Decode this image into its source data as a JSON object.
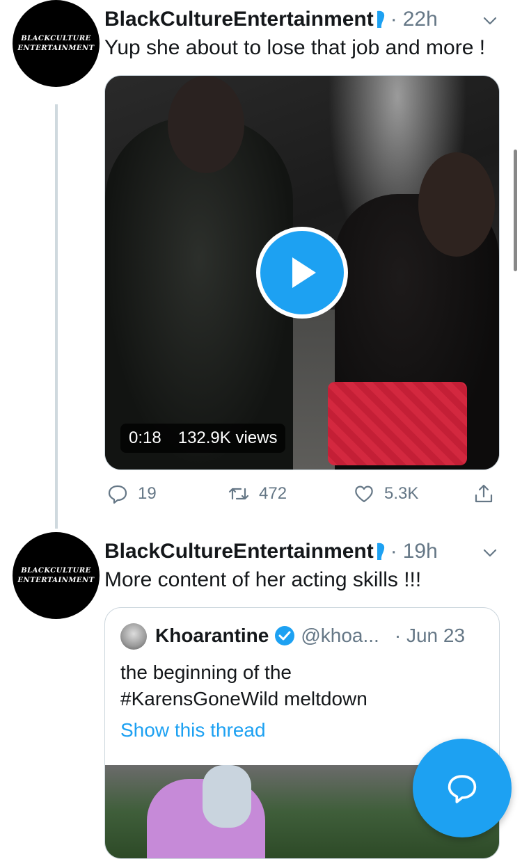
{
  "tweets": [
    {
      "author": "BlackCultureEntertainment",
      "avatar_text": [
        "BLACKCULTURE",
        "ENTERTAINMENT"
      ],
      "time": "22h",
      "dot": "·",
      "text": "Yup she about to lose that job and more !",
      "video": {
        "duration": "0:18",
        "views": "132.9K views"
      },
      "actions": {
        "replies": "19",
        "retweets": "472",
        "likes": "5.3K"
      }
    },
    {
      "author": "BlackCultureEntertainment",
      "avatar_text": [
        "BLACKCULTURE",
        "ENTERTAINMENT"
      ],
      "time": "19h",
      "dot": "·",
      "text": "More content of her acting skills !!!",
      "quote": {
        "name": "Khoarantine",
        "handle": "@khoa...",
        "dot": "·",
        "date": "Jun 23",
        "text_line1": "the beginning of the",
        "text_line2": "#KarensGoneWild  meltdown",
        "link": "Show this thread"
      }
    }
  ],
  "colors": {
    "accent": "#1da1f2",
    "muted": "#657786",
    "text": "#14171a",
    "flag": "#1da1f2"
  },
  "icons": [
    "chevron-down-icon",
    "play-icon",
    "reply-icon",
    "retweet-icon",
    "like-icon",
    "share-icon",
    "verified-icon",
    "compose-reply-icon",
    "flag-icon"
  ]
}
